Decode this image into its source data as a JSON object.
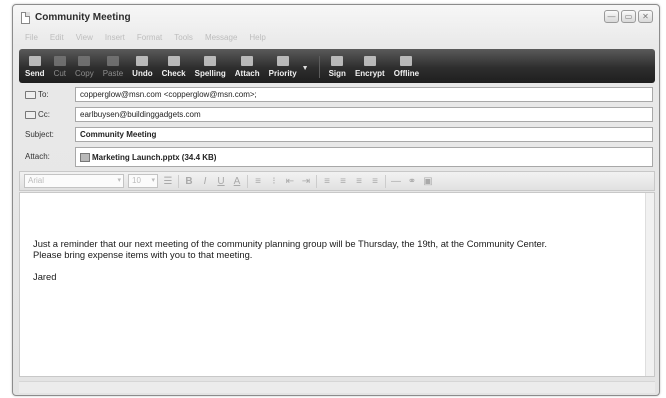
{
  "window": {
    "title": "Community Meeting",
    "controls": [
      "—",
      "▭",
      "✕"
    ]
  },
  "menu": [
    "File",
    "Edit",
    "View",
    "Insert",
    "Format",
    "Tools",
    "Message",
    "Help"
  ],
  "toolbar": [
    {
      "label": "Send",
      "icon": "send-icon",
      "enabled": true
    },
    {
      "label": "Cut",
      "icon": "scissors-icon",
      "enabled": false
    },
    {
      "label": "Copy",
      "icon": "copy-icon",
      "enabled": false
    },
    {
      "label": "Paste",
      "icon": "paste-icon",
      "enabled": false
    },
    {
      "label": "Undo",
      "icon": "undo-icon",
      "enabled": true
    },
    {
      "label": "Check",
      "icon": "check-icon",
      "enabled": true
    },
    {
      "label": "Spelling",
      "icon": "spelling-icon",
      "enabled": true
    },
    {
      "label": "Attach",
      "icon": "paperclip-icon",
      "enabled": true
    },
    {
      "label": "Priority",
      "icon": "priority-icon",
      "enabled": true
    },
    {
      "label": "Sign",
      "icon": "sign-icon",
      "enabled": true
    },
    {
      "label": "Encrypt",
      "icon": "encrypt-icon",
      "enabled": true
    },
    {
      "label": "Offline",
      "icon": "offline-icon",
      "enabled": true
    }
  ],
  "headers": {
    "to_label": "To:",
    "to_value": "copperglow@msn.com <copperglow@msn.com>;",
    "cc_label": "Cc:",
    "cc_value": "earlbuysen@buildinggadgets.com",
    "subject_label": "Subject:",
    "subject_value": "Community Meeting",
    "attach_label": "Attach:",
    "attach_value": "Marketing Launch.pptx (34.4 KB)"
  },
  "format": {
    "font": "Arial",
    "size": "10",
    "buttons": [
      "B",
      "I",
      "U",
      "A"
    ]
  },
  "body": {
    "line1": "Just a reminder that our next meeting of the community planning group will be Thursday, the 19th, at the Community Center.",
    "line2": "Please bring expense items with you to that meeting.",
    "signoff": "Jared"
  },
  "colors": {
    "toolbar_bg": "#2e2e2e",
    "window_border": "#8c8c8c"
  }
}
